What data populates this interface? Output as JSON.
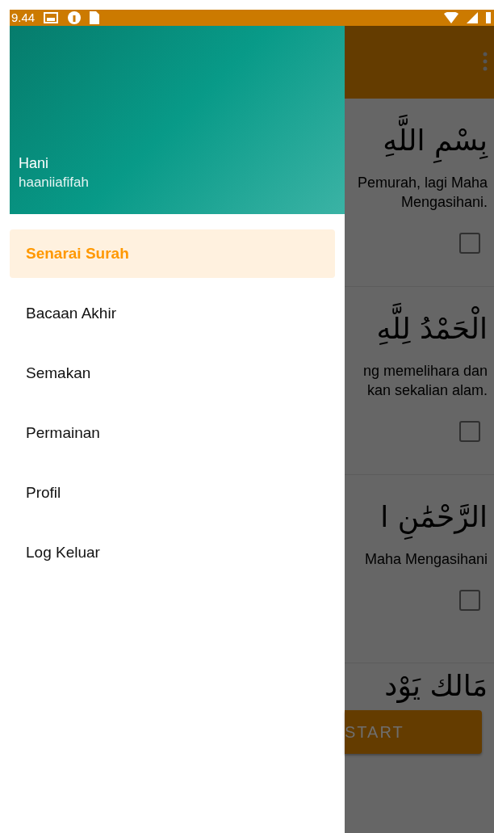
{
  "status_bar": {
    "time": "9.44"
  },
  "drawer": {
    "header": {
      "name": "Hani",
      "username": "haaniiafifah"
    },
    "items": [
      {
        "label": "Senarai Surah",
        "selected": true
      },
      {
        "label": "Bacaan Akhir",
        "selected": false
      },
      {
        "label": "Semakan",
        "selected": false
      },
      {
        "label": "Permainan",
        "selected": false
      },
      {
        "label": "Profil",
        "selected": false
      },
      {
        "label": "Log Keluar",
        "selected": false
      }
    ]
  },
  "verses": [
    {
      "arabic": "بِسْمِ اللَّهِ",
      "translation": [
        "Pemurah, lagi Maha",
        "Mengasihani."
      ],
      "checked": false
    },
    {
      "arabic": "الْحَمْدُ لِلَّهِ",
      "translation": [
        "ng memelihara dan",
        "kan sekalian alam."
      ],
      "checked": false
    },
    {
      "arabic": "الرَّحْمَٰنِ ا",
      "translation": [
        "Maha Mengasihani"
      ],
      "checked": false
    },
    {
      "arabic": "مَالك يَوْد"
    }
  ],
  "start_button": {
    "label": "START"
  }
}
